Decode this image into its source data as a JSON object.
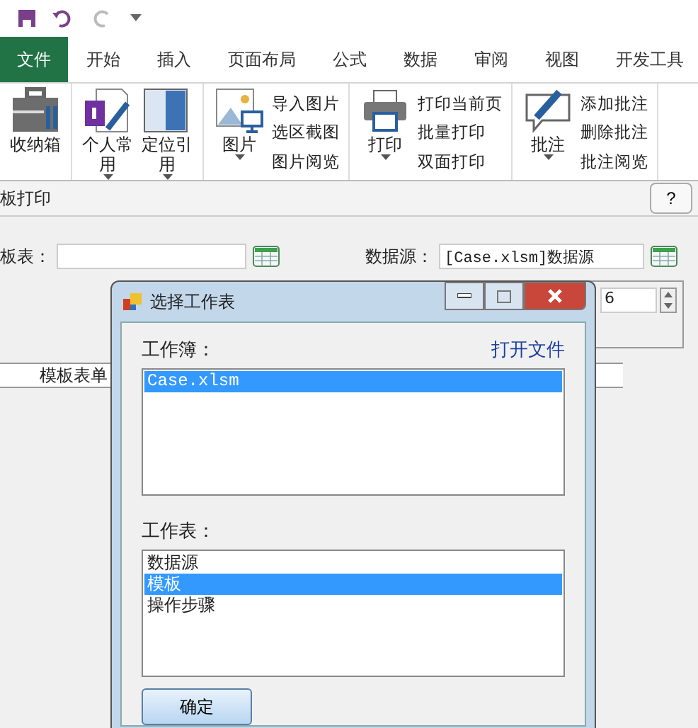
{
  "tabs": [
    {
      "label": "文件",
      "kind": "file",
      "selected": false
    },
    {
      "label": "开始",
      "kind": "tab",
      "selected": false
    },
    {
      "label": "插入",
      "kind": "tab",
      "selected": false
    },
    {
      "label": "页面布局",
      "kind": "tab",
      "selected": false
    },
    {
      "label": "公式",
      "kind": "tab",
      "selected": false
    },
    {
      "label": "数据",
      "kind": "tab",
      "selected": false
    },
    {
      "label": "审阅",
      "kind": "tab",
      "selected": false
    },
    {
      "label": "视图",
      "kind": "tab",
      "selected": false
    },
    {
      "label": "开发工具",
      "kind": "tab",
      "selected": false
    }
  ],
  "ribbon": [
    {
      "large": [
        {
          "label": "收纳箱",
          "dropdown": false
        }
      ]
    },
    {
      "large": [
        {
          "label": "个人常用",
          "dropdown": true
        },
        {
          "label": "定位引用",
          "dropdown": true
        }
      ]
    },
    {
      "large": [
        {
          "label": "图片",
          "dropdown": true
        }
      ],
      "small": [
        "导入图片",
        "选区截图",
        "图片阅览"
      ]
    },
    {
      "large": [
        {
          "label": "打印",
          "dropdown": true
        }
      ],
      "small": [
        "打印当前页",
        "批量打印",
        "双面打印"
      ]
    },
    {
      "large": [
        {
          "label": "批注",
          "dropdown": true
        }
      ],
      "small": [
        "添加批注",
        "删除批注",
        "批注阅览"
      ]
    }
  ],
  "panel": {
    "title": "板打印",
    "help": "?",
    "template_label": "板表：",
    "source_label": "数据源：",
    "source_value": "[Case.xlsm]数据源",
    "spin_value": "6",
    "column_1": "模板表单"
  },
  "dialog": {
    "title": "选择工作表",
    "workbook_label": "工作簿：",
    "open_link": "打开文件",
    "workbooks": [
      {
        "label": "Case.xlsm",
        "selected": true
      }
    ],
    "sheet_label": "工作表：",
    "sheets": [
      {
        "label": "数据源",
        "selected": false
      },
      {
        "label": "模板",
        "selected": true
      },
      {
        "label": "操作步骤",
        "selected": false
      }
    ],
    "ok": "确定"
  }
}
